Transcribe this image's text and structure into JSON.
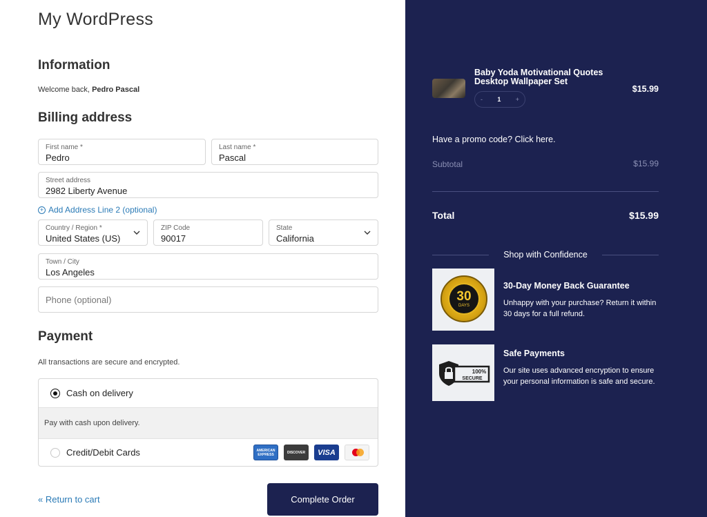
{
  "site": {
    "title": "My WordPress"
  },
  "information": {
    "heading": "Information",
    "welcome_prefix": "Welcome back,",
    "user_name": "Pedro Pascal"
  },
  "billing": {
    "heading": "Billing address",
    "first_name": {
      "label": "First name *",
      "value": "Pedro"
    },
    "last_name": {
      "label": "Last name *",
      "value": "Pascal"
    },
    "street": {
      "label": "Street address",
      "value": "2982 Liberty Avenue"
    },
    "add_line_2": "Add Address Line 2 (optional)",
    "country": {
      "label": "Country / Region *",
      "value": "United States (US)"
    },
    "zip": {
      "label": "ZIP Code",
      "value": "90017"
    },
    "state": {
      "label": "State",
      "value": "California"
    },
    "city": {
      "label": "Town / City",
      "value": "Los Angeles"
    },
    "phone": {
      "placeholder": "Phone (optional)"
    }
  },
  "payment": {
    "heading": "Payment",
    "note": "All transactions are secure and encrypted.",
    "methods": [
      {
        "label": "Cash on delivery",
        "selected": true,
        "description": "Pay with cash upon delivery."
      },
      {
        "label": "Credit/Debit Cards",
        "selected": false
      }
    ],
    "card_logos": [
      "AMERICAN EXPRESS",
      "DISCOVER",
      "VISA",
      "mastercard"
    ]
  },
  "actions": {
    "return_label": "« Return to cart",
    "complete_label": "Complete Order",
    "button_color": "#1c2250"
  },
  "summary": {
    "panel_color": "#1c2250",
    "product": {
      "title": "Baby Yoda Motivational Quotes Desktop Wallpaper Set",
      "price": "$15.99",
      "quantity": "1",
      "minus": "-",
      "plus": "+"
    },
    "promo": "Have a promo code? Click here.",
    "subtotal_label": "Subtotal",
    "subtotal_value": "$15.99",
    "total_label": "Total",
    "total_value": "$15.99",
    "confidence_heading": "Shop with Confidence",
    "features": [
      {
        "title": "30-Day Money Back Guarantee",
        "description": "Unhappy with your purchase? Return it within 30 days for a full refund.",
        "badge_top": "MONEY BACK",
        "badge_number": "30",
        "badge_unit": "DAYS",
        "badge_bottom": "GUARANTEE"
      },
      {
        "title": "Safe Payments",
        "description": "Our site uses advanced encryption to ensure your personal information is safe and secure.",
        "badge_text_1": "100%",
        "badge_text_2": "SECURE"
      }
    ]
  }
}
